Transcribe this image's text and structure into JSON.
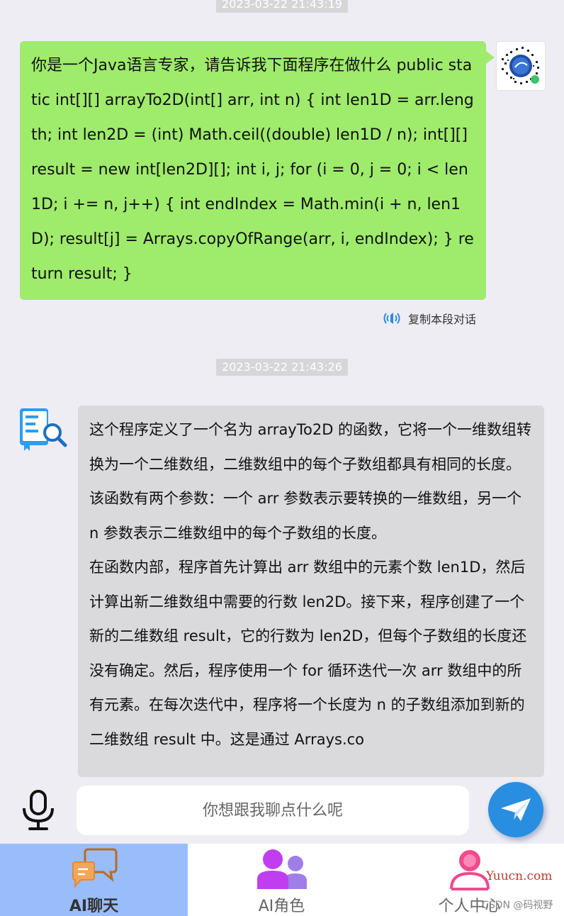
{
  "messages": {
    "user": {
      "time": "2023-03-22 21:43:19",
      "text": "你是一个Java语言专家，请告诉我下面程序在做什么 public static int[][] arrayTo2D(int[] arr, int n) { int len1D = arr.length; int len2D = (int) Math.ceil((double) len1D / n); int[][] result = new int[len2D][]; int i, j; for (i = 0, j = 0; i < len1D; i += n, j++) { int endIndex = Math.min(i + n, len1D); result[j] = Arrays.copyOfRange(arr, i, endIndex); } return result; }",
      "copy_label": "复制本段对话"
    },
    "bot": {
      "time": "2023-03-22 21:43:26",
      "paragraphs": [
        "这个程序定义了一个名为 arrayTo2D 的函数，它将一个一维数组转换为一个二维数组，二维数组中的每个子数组都具有相同的长度。该函数有两个参数：一个 arr 参数表示要转换的一维数组，另一个 n 参数表示二维数组中的每个子数组的长度。",
        "在函数内部，程序首先计算出 arr 数组中的元素个数 len1D，然后计算出新二维数组中需要的行数 len2D。接下来，程序创建了一个新的二维数组 result，它的行数为 len2D，但每个子数组的长度还没有确定。然后，程序使用一个 for 循环迭代一次 arr 数组中的所有元素。在每次迭代中，程序将一个长度为 n 的子数组添加到新的二维数组 result 中。这是通过 Arrays.co"
      ]
    }
  },
  "input": {
    "placeholder": "你想跟我聊点什么呢"
  },
  "tabs": [
    {
      "label": "AI聊天",
      "icon": "chat-bubbles-icon",
      "active": true
    },
    {
      "label": "AI角色",
      "icon": "users-icon",
      "active": false
    },
    {
      "label": "个人中心",
      "icon": "person-icon",
      "active": false
    }
  ],
  "watermark": {
    "site": "Yuucn.com",
    "author": "CSDN @码视野"
  },
  "colors": {
    "user_bubble": "#9feb6c",
    "bot_bubble": "#dadadd",
    "background": "#efedf4",
    "active_tab": "#99bdfb",
    "send_button": "#2a8ee0"
  }
}
